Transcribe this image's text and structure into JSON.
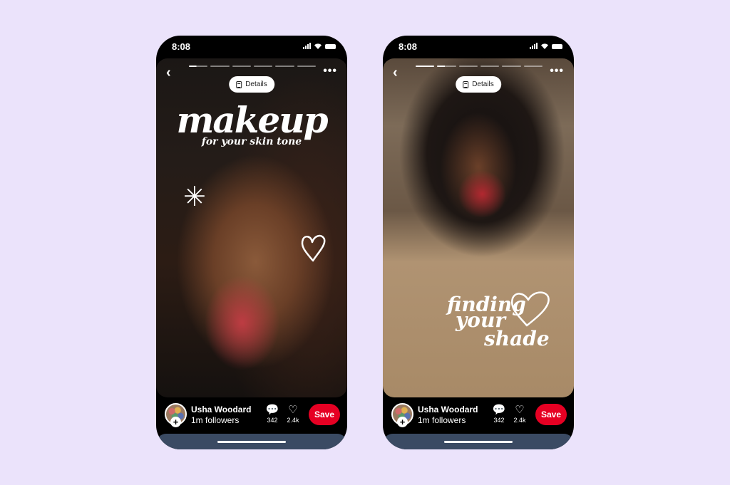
{
  "background_color": "#ebe3fb",
  "phones": [
    {
      "status": {
        "time": "8:08"
      },
      "progress": {
        "segments": 7,
        "current_index": 0,
        "current_fraction": 0.3
      },
      "details_label": "Details",
      "headline": {
        "title": "makeup",
        "subtitle": "for your skin tone"
      },
      "creator": {
        "name": "Usha Woodard",
        "followers": "1m followers"
      },
      "stats": {
        "comments": "342",
        "likes": "2.4k"
      },
      "save_label": "Save"
    },
    {
      "status": {
        "time": "8:08"
      },
      "progress": {
        "segments": 7,
        "current_index": 1,
        "current_fraction": 0.4
      },
      "details_label": "Details",
      "headline": {
        "lines": [
          "finding",
          "your",
          "shade"
        ]
      },
      "creator": {
        "name": "Usha Woodard",
        "followers": "1m followers"
      },
      "stats": {
        "comments": "342",
        "likes": "2.4k"
      },
      "save_label": "Save"
    }
  ],
  "colors": {
    "save": "#e60023",
    "bottom_bar": "#3a4a63"
  }
}
